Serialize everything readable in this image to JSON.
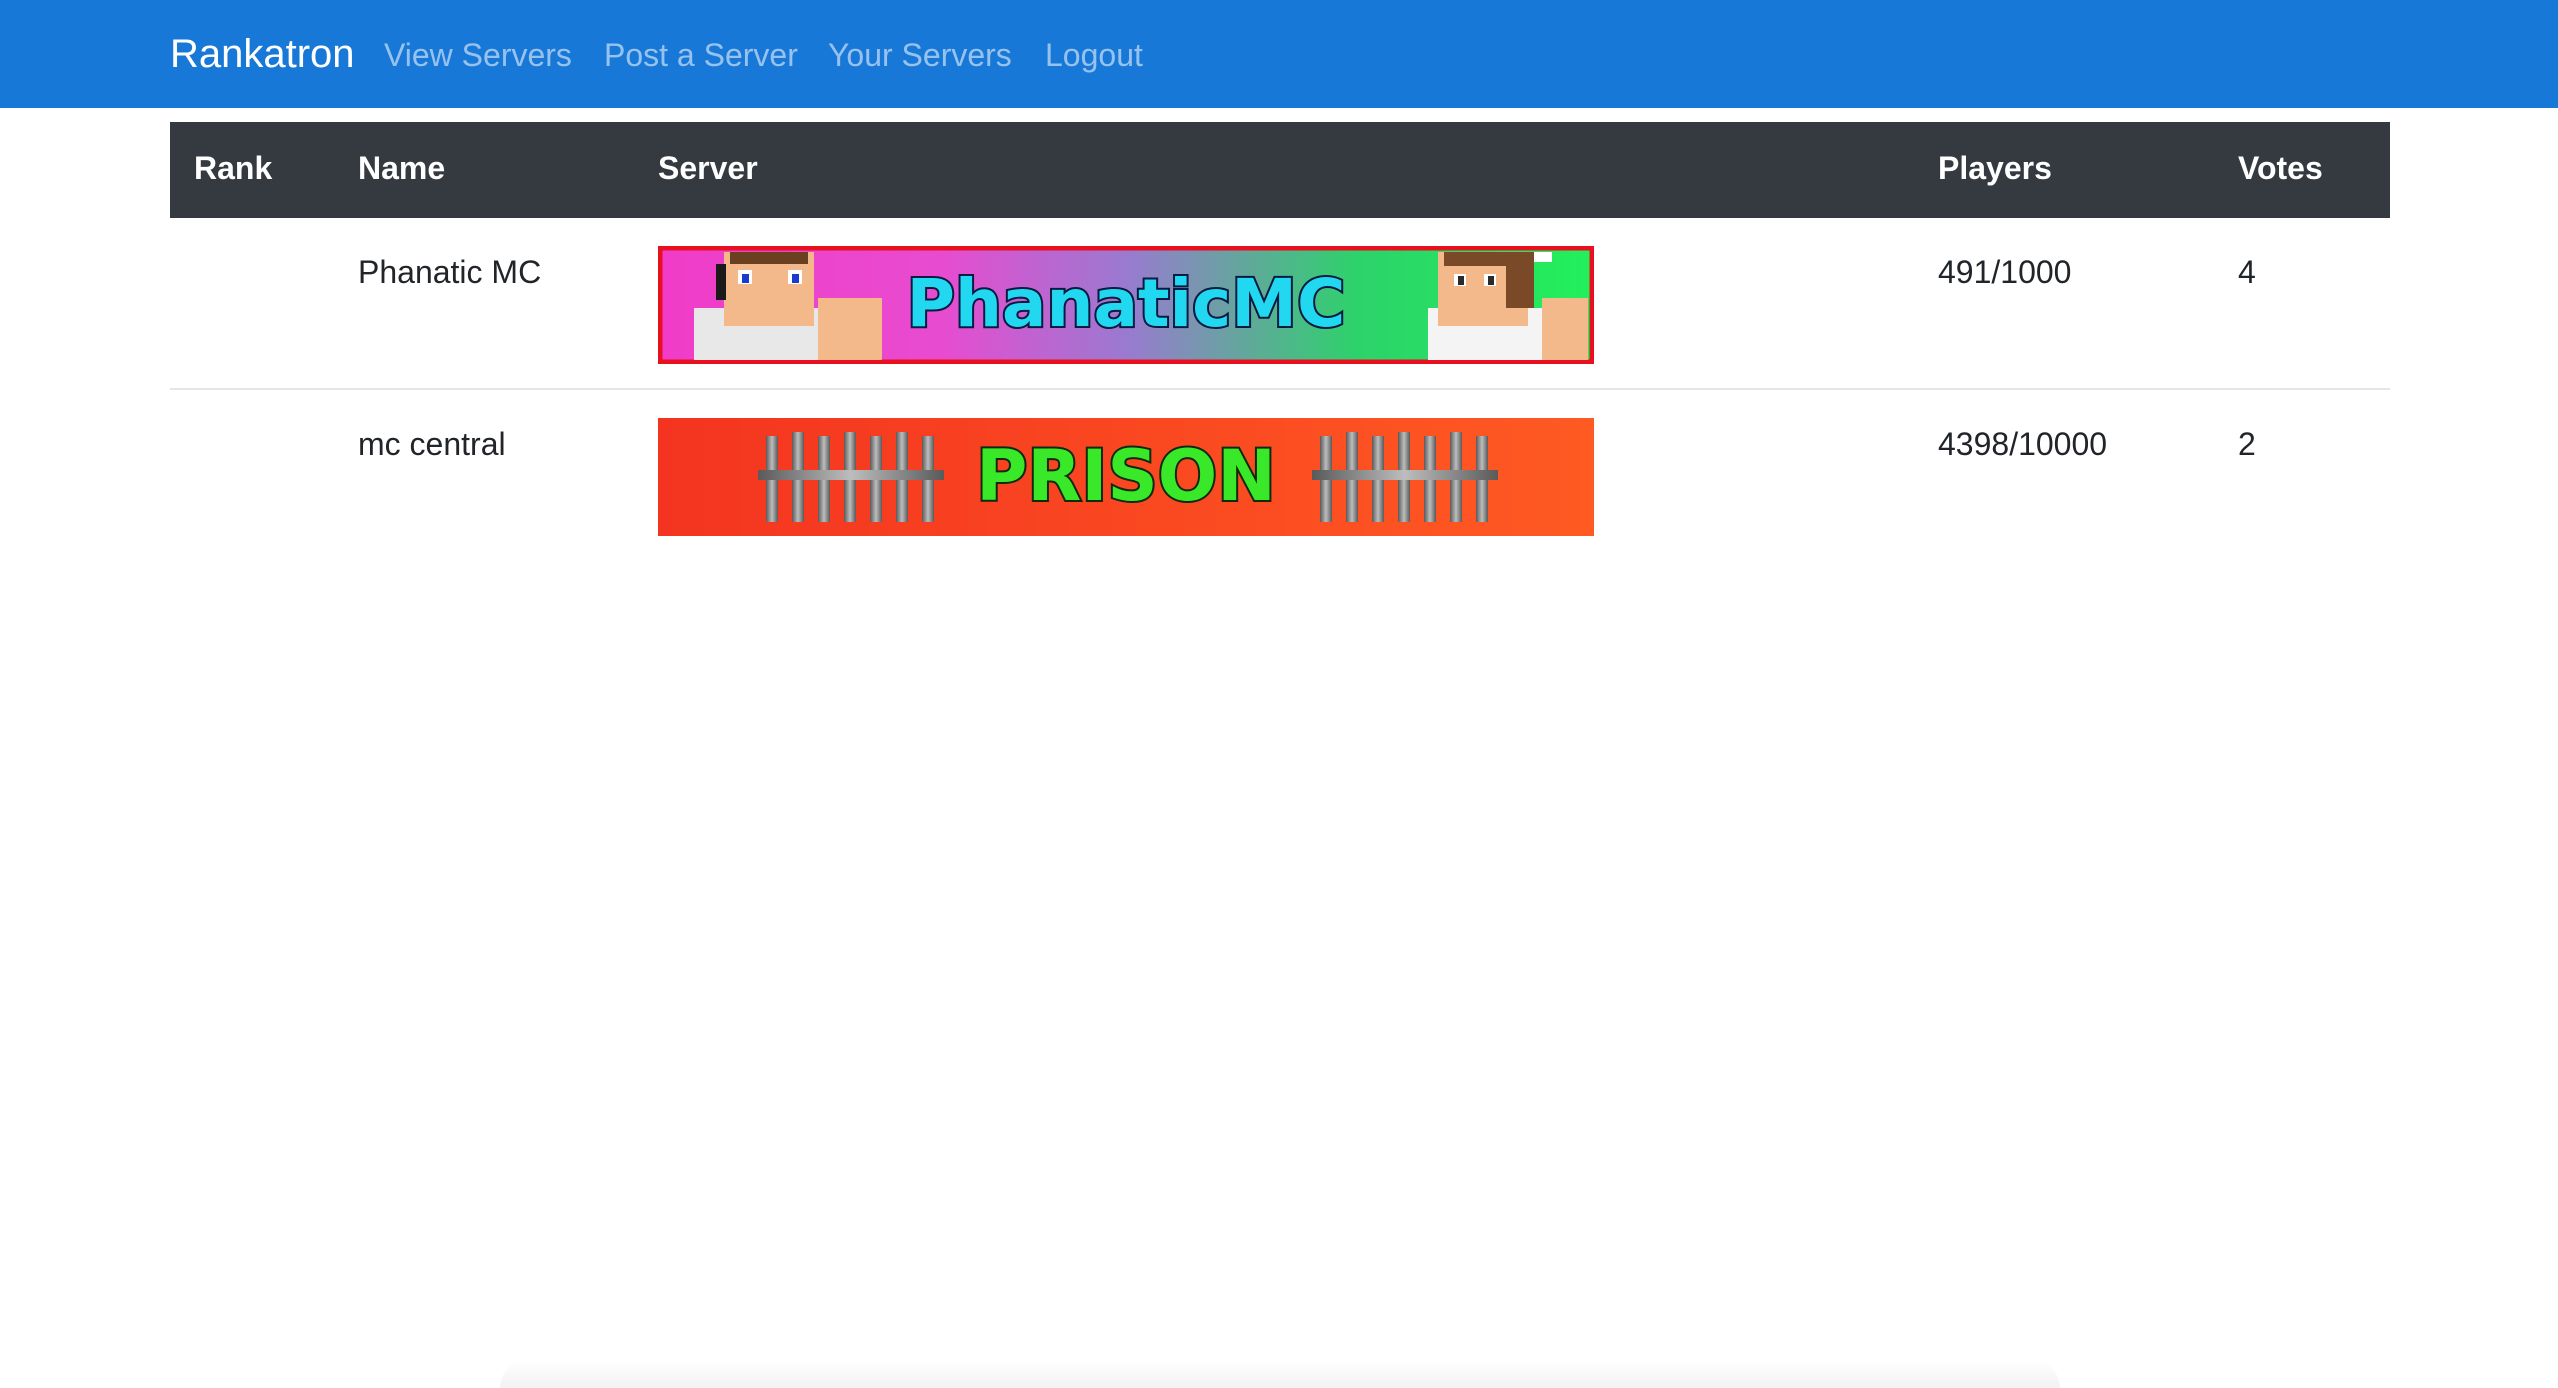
{
  "navbar": {
    "brand": "Rankatron",
    "links": [
      "View Servers",
      "Post a Server",
      "Your Servers",
      "Logout"
    ]
  },
  "table": {
    "headers": {
      "rank": "Rank",
      "name": "Name",
      "server": "Server",
      "players": "Players",
      "votes": "Votes"
    },
    "rows": [
      {
        "rank": "",
        "name": "Phanatic MC",
        "banner_text": "PhanaticMC",
        "players": "491/1000",
        "votes": "4"
      },
      {
        "rank": "",
        "name": "mc central",
        "banner_text": "PRISON",
        "players": "4398/10000",
        "votes": "2"
      }
    ]
  },
  "colors": {
    "navbar_bg": "#1778d8",
    "table_header_bg": "#343a40",
    "banner1_border": "#e8101f",
    "banner2_bg": "#f43c20"
  }
}
